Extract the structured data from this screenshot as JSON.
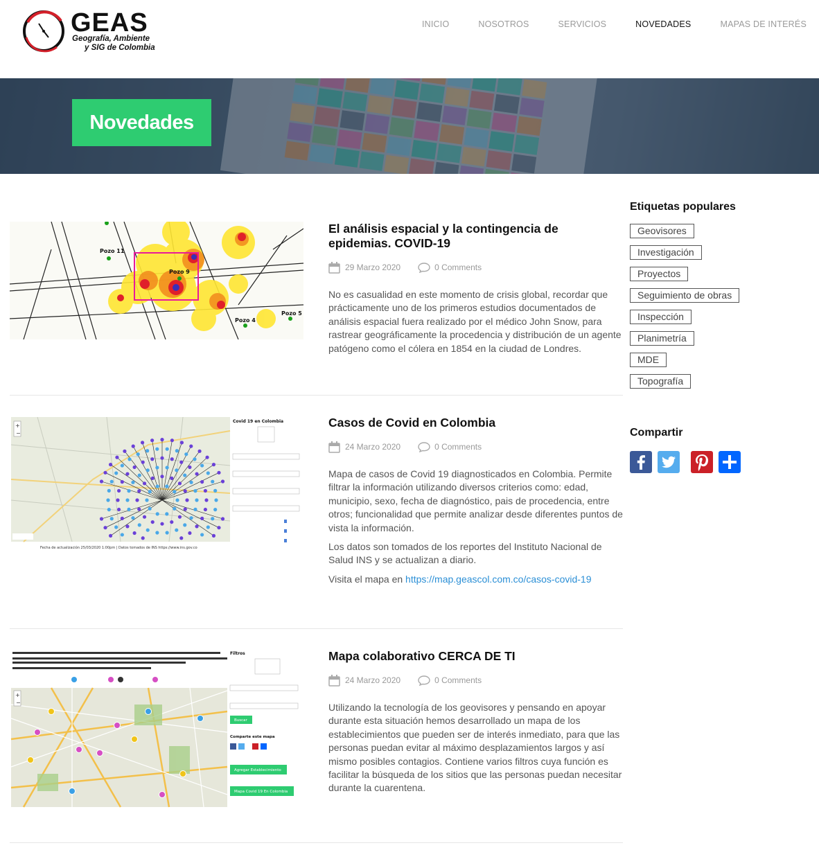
{
  "brand": {
    "name": "GEAS",
    "tagline_line1": "Geografía, Ambiente",
    "tagline_line2": "y SIG de Colombia"
  },
  "nav": {
    "items": [
      {
        "label": "INICIO"
      },
      {
        "label": "NOSOTROS"
      },
      {
        "label": "SERVICIOS"
      },
      {
        "label": "NOVEDADES"
      },
      {
        "label": "MAPAS DE INTERÉS"
      }
    ],
    "active": "NOVEDADES"
  },
  "banner": {
    "title": "Novedades"
  },
  "posts": [
    {
      "title": "El análisis espacial y la contingencia de epidemias. COVID-19",
      "date": "29 Marzo 2020",
      "comments": "0 Comments",
      "paragraphs": [
        "No es casualidad en este momento de crisis global, recordar que prácticamente uno de los primeros estudios documentados de análisis espacial fuera realizado por el médico John Snow, para rastrear geográficamente la procedencia y distribución de un agente patógeno como el cólera en 1854 en la ciudad de Londres."
      ],
      "thumb_labels": [
        "Pozo 11",
        "Pozo 9",
        "Pozo 4",
        "Pozo 5"
      ]
    },
    {
      "title": "Casos de Covid en Colombia",
      "date": "24 Marzo 2020",
      "comments": "0 Comments",
      "paragraphs": [
        "Mapa de casos de Covid 19 diagnosticados en Colombia. Permite filtrar la información utilizando diversos criterios como: edad, municipio, sexo, fecha de diagnóstico, pais de procedencia, entre otros; funcionalidad que permite analizar desde diferentes puntos de vista la información.",
        "Los datos son tomados de los reportes del Instituto Nacional de Salud INS y se actualizan a diario."
      ],
      "link_prefix": "Visita el mapa en ",
      "link_text": "https://map.geascol.com.co/casos-covid-19",
      "thumb_panel_title": "Covid 19 en Colombia",
      "thumb_footer": "Fecha de actualización 25/03/2020 1:00pm | Datos tomados de INS https://www.ins.gov.co"
    },
    {
      "title": "Mapa colaborativo CERCA DE TI",
      "date": "24 Marzo 2020",
      "comments": "0 Comments",
      "paragraphs": [
        "Utilizando la tecnología de los geovisores y pensando en apoyar durante esta situación hemos desarrollado un mapa de los establecimientos que pueden ser de interés inmediato, para que las personas puedan evitar al máximo desplazamientos largos y así mismo posibles contagios. Contiene varios filtros cuya función es facilitar la búsqueda de los sitios que las personas puedan necesitar durante la cuarentena."
      ],
      "thumb_panel_title": "Filtros",
      "thumb_buttons": [
        "Buscar",
        "Agregar Establecimiento",
        "Mapa Covid 19 En Colombia"
      ],
      "thumb_share": "Comparte este mapa"
    }
  ],
  "sidebar": {
    "tags_title": "Etiquetas populares",
    "tags": [
      "Geovisores",
      "Investigación",
      "Proyectos",
      "Seguimiento de obras",
      "Inspección",
      "Planimetría",
      "MDE",
      "Topografía"
    ],
    "share_title": "Compartir",
    "share_icons": [
      "facebook-icon",
      "twitter-icon",
      "pinterest-icon",
      "share-plus-icon"
    ]
  },
  "colors": {
    "accent_green": "#2ecc71",
    "link_blue": "#2b8fd6",
    "facebook": "#3b5998",
    "twitter": "#55acee",
    "pinterest": "#cb2027",
    "share": "#0166ff"
  }
}
